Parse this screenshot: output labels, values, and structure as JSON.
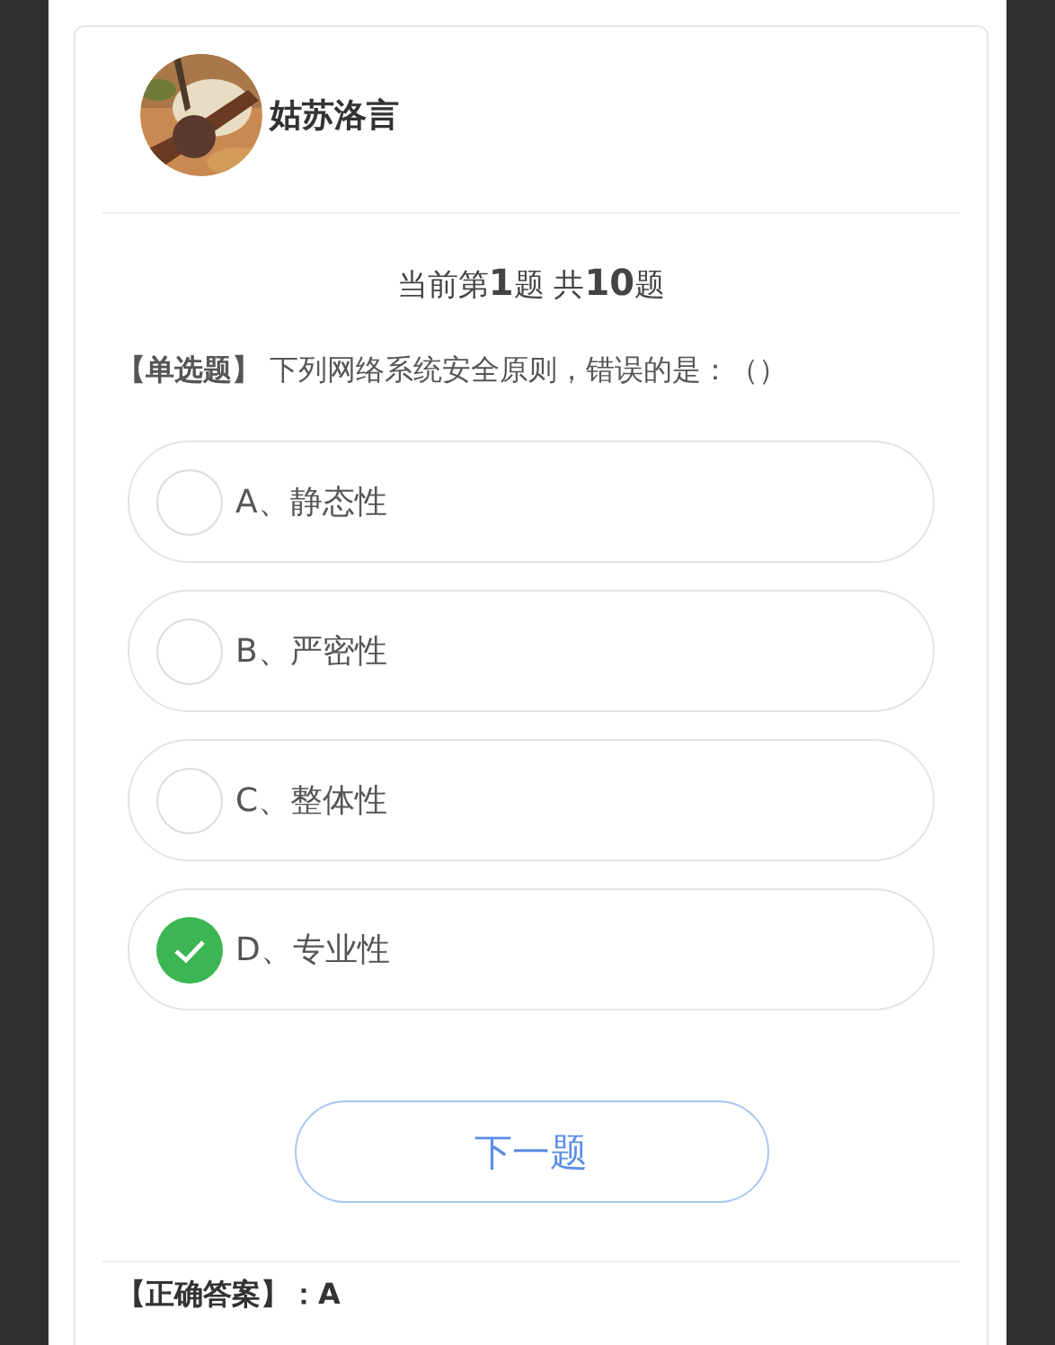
{
  "user": {
    "name": "姑苏洛言"
  },
  "progress": "当前第**1**题 共**10**题",
  "question": "**【单选题】** 下列网络系统安全原则，错误的是：（）",
  "options": [
    {
      "label": "A、静态性",
      "selected": false
    },
    {
      "label": "B、严密性",
      "selected": false
    },
    {
      "label": "C、整体性",
      "selected": false
    },
    {
      "label": "D、专业性",
      "selected": true
    }
  ],
  "next_button": "下一题",
  "answer": "【正确答案】：A"
}
